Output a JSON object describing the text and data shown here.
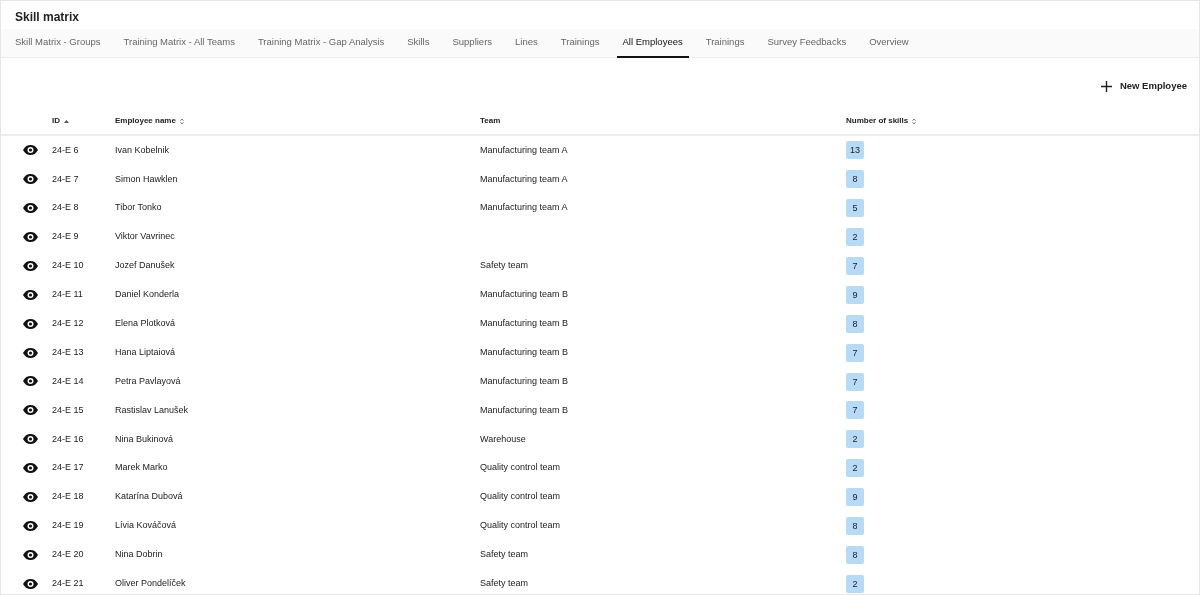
{
  "app_title": "Skill matrix",
  "tabs": [
    {
      "label": "Skill Matrix - Groups",
      "selected": false
    },
    {
      "label": "Training Matrix - All Teams",
      "selected": false
    },
    {
      "label": "Training Matrix - Gap Analysis",
      "selected": false
    },
    {
      "label": "Skills",
      "selected": false
    },
    {
      "label": "Suppliers",
      "selected": false
    },
    {
      "label": "Lines",
      "selected": false
    },
    {
      "label": "Trainings",
      "selected": false
    },
    {
      "label": "All Employees",
      "selected": true
    },
    {
      "label": "Trainings",
      "selected": false
    },
    {
      "label": "Survey Feedbacks",
      "selected": false
    },
    {
      "label": "Overview",
      "selected": false
    }
  ],
  "new_button": "New Employee",
  "table": {
    "columns": [
      {
        "label": "ID",
        "sorted": true
      },
      {
        "label": "Employee name",
        "sorted": false
      },
      {
        "label": "Team"
      },
      {
        "label": "Number of skills",
        "sorted": false
      }
    ],
    "rows": [
      {
        "id": "24-E 6",
        "name": "Ivan Kobelnik",
        "team": "Manufacturing team A",
        "skills": "13"
      },
      {
        "id": "24-E 7",
        "name": "Simon Hawklen",
        "team": "Manufacturing team A",
        "skills": "8"
      },
      {
        "id": "24-E 8",
        "name": "Tibor Tonko",
        "team": "Manufacturing team A",
        "skills": "5"
      },
      {
        "id": "24-E 9",
        "name": "Viktor Vavrinec",
        "skills": "2"
      },
      {
        "id": "24-E 10",
        "name": "Jozef Danušek",
        "team": "Safety team",
        "skills": "7"
      },
      {
        "id": "24-E 11",
        "name": "Daniel Konderla",
        "team": "Manufacturing team B",
        "skills": "9"
      },
      {
        "id": "24-E 12",
        "name": "Elena Plotková",
        "team": "Manufacturing team B",
        "skills": "8"
      },
      {
        "id": "24-E 13",
        "name": "Hana Liptaiová",
        "team": "Manufacturing team B",
        "skills": "7"
      },
      {
        "id": "24-E 14",
        "name": "Petra Pavlayová",
        "team": "Manufacturing team B",
        "skills": "7"
      },
      {
        "id": "24-E 15",
        "name": "Rastislav Lanušek",
        "team": "Manufacturing team B",
        "skills": "7"
      },
      {
        "id": "24-E 16",
        "name": "Nina Bukinová",
        "team": "Warehouse",
        "skills": "2"
      },
      {
        "id": "24-E 17",
        "name": "Marek Marko",
        "team": "Quality control team",
        "skills": "2"
      },
      {
        "id": "24-E 18",
        "name": "Katarína Dubová",
        "team": "Quality control team",
        "skills": "9"
      },
      {
        "id": "24-E 19",
        "name": "Lívia Kováčová",
        "team": "Quality control team",
        "skills": "8"
      },
      {
        "id": "24-E 20",
        "name": "Nina Dobrin",
        "team": "Safety team",
        "skills": "8"
      },
      {
        "id": "24-E 21",
        "name": "Oliver Pondelíček",
        "team": "Safety team",
        "skills": "2"
      }
    ]
  }
}
